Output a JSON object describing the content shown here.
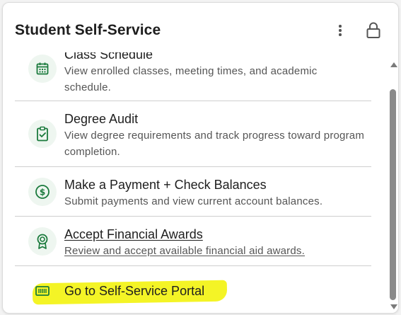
{
  "header": {
    "title": "Student Self-Service",
    "menu_icon": "kebab-menu-icon",
    "lock_icon": "lock-icon"
  },
  "colors": {
    "accent": "#1a7a3c",
    "icon_bg": "#eef6f0",
    "highlight": "#f2f200"
  },
  "items": [
    {
      "title": "Class Schedule",
      "description": "View enrolled classes, meeting times, and academic schedule.",
      "icon": "calendar-icon"
    },
    {
      "title": "Degree Audit",
      "description": "View degree requirements and track progress toward program completion.",
      "icon": "clipboard-check-icon"
    },
    {
      "title": "Make a Payment + Check Balances",
      "description": "Submit payments and view current account balances.",
      "icon": "dollar-circle-icon"
    },
    {
      "title": "Accept Financial Awards",
      "description": "Review and accept available financial aid awards.",
      "icon": "award-ribbon-icon"
    },
    {
      "title": "Go to Self-Service Portal",
      "icon": "portal-icon"
    }
  ]
}
